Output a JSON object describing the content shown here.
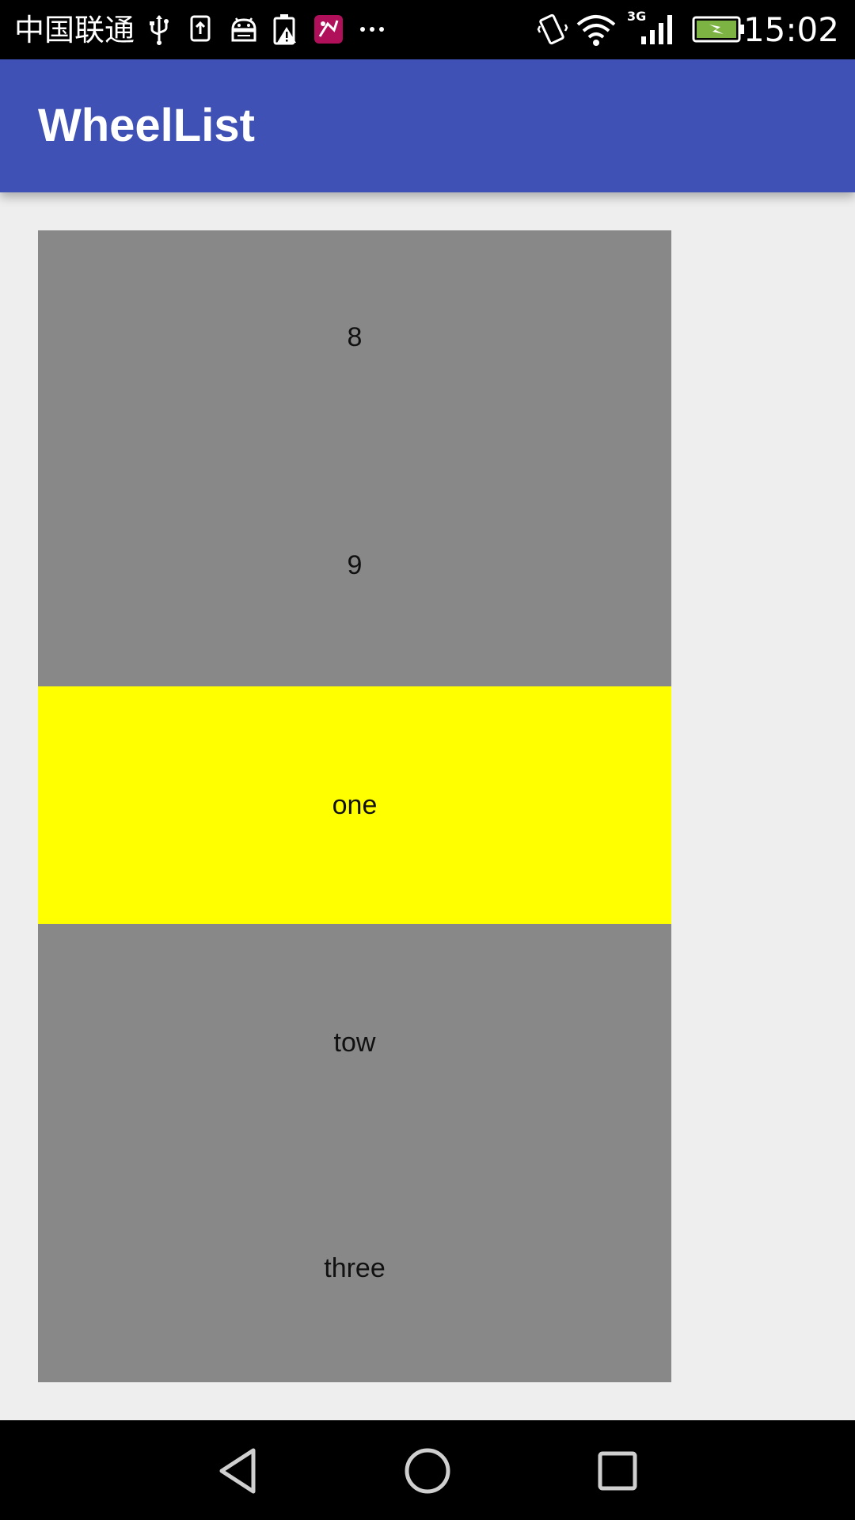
{
  "status_bar": {
    "carrier": "中国联通",
    "network_type": "3G",
    "time": "15:02",
    "icons": [
      "usb-icon",
      "upload-icon",
      "android-debug-icon",
      "battery-warning-icon",
      "app-notification-icon",
      "more-icon",
      "vibrate-icon",
      "wifi-icon",
      "signal-icon",
      "battery-charging-icon"
    ],
    "battery_color": "#7cb342"
  },
  "app_bar": {
    "title": "WheelList",
    "color": "#3f51b5"
  },
  "wheel_list": {
    "items": [
      {
        "label": "8",
        "selected": false
      },
      {
        "label": "9",
        "selected": false
      },
      {
        "label": "one",
        "selected": true
      },
      {
        "label": "tow",
        "selected": false
      },
      {
        "label": "three",
        "selected": false
      }
    ],
    "background_color": "#888888",
    "selected_color": "#ffff00"
  },
  "nav_bar": {
    "buttons": [
      "back-icon",
      "home-icon",
      "recents-icon"
    ]
  }
}
